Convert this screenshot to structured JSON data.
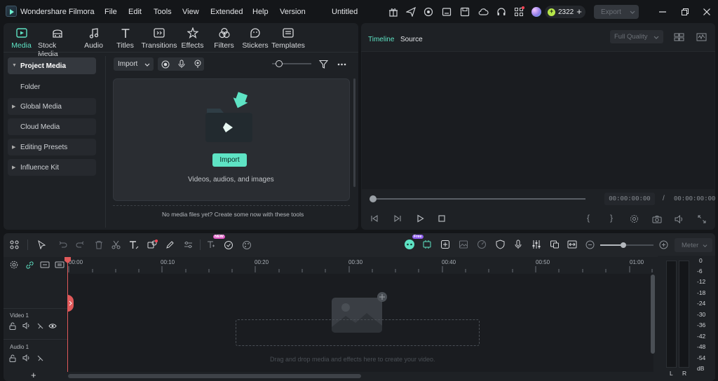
{
  "app": {
    "name": "Wondershare Filmora",
    "project_title": "Untitled"
  },
  "menu": [
    "File",
    "Edit",
    "Tools",
    "View",
    "Extended",
    "Help",
    "Version"
  ],
  "titlebar": {
    "credits": "2322",
    "export_label": "Export"
  },
  "toolbar_tabs": [
    {
      "label": "Media",
      "icon": "media-icon",
      "active": true
    },
    {
      "label": "Stock Media",
      "icon": "stock-media-icon"
    },
    {
      "label": "Audio",
      "icon": "music-note-icon"
    },
    {
      "label": "Titles",
      "icon": "text-t-icon"
    },
    {
      "label": "Transitions",
      "icon": "transitions-icon"
    },
    {
      "label": "Effects",
      "icon": "effects-star-icon"
    },
    {
      "label": "Filters",
      "icon": "filters-icon"
    },
    {
      "label": "Stickers",
      "icon": "sticker-icon"
    },
    {
      "label": "Templates",
      "icon": "templates-icon"
    }
  ],
  "sidebar": {
    "items": [
      {
        "label": "Project Media",
        "arrow": true,
        "active": true
      },
      {
        "label": "Folder",
        "arrow": false
      },
      {
        "label": "Global Media",
        "arrow": true
      },
      {
        "label": "Cloud Media",
        "arrow": false
      },
      {
        "label": "Editing Presets",
        "arrow": true
      },
      {
        "label": "Influence Kit",
        "arrow": true
      }
    ]
  },
  "media": {
    "import_dropdown": "Import",
    "import_button": "Import",
    "hint": "Videos, audios, and images",
    "empty_note": "No media files yet? Create some now with these tools"
  },
  "preview": {
    "tabs": [
      "Timeline",
      "Source"
    ],
    "quality": "Full Quality",
    "current_time": "00:00:00:00",
    "separator": "/",
    "total_time": "00:00:00:00",
    "brace_open": "{",
    "brace_close": "}"
  },
  "timeline": {
    "ruler": [
      "00:00",
      "00:10",
      "00:20",
      "00:30",
      "00:40",
      "00:50",
      "01:00"
    ],
    "tracks": [
      {
        "label": "Video 1"
      },
      {
        "label": "Audio 1"
      }
    ],
    "drop_hint": "Drag and drop media and effects here to create your video.",
    "meter_label": "Meter",
    "new_badge": "NEW",
    "free_badge": "Free",
    "add_track": "+"
  },
  "meter": {
    "scale": [
      "0",
      "-6",
      "-12",
      "-18",
      "-24",
      "-30",
      "-36",
      "-42",
      "-48",
      "-54",
      "dB"
    ],
    "channels": [
      "L",
      "R"
    ]
  },
  "colors": {
    "accent": "#5ee3c4",
    "playhead": "#e0595a",
    "background": "#141619",
    "panel": "#1e2125"
  }
}
